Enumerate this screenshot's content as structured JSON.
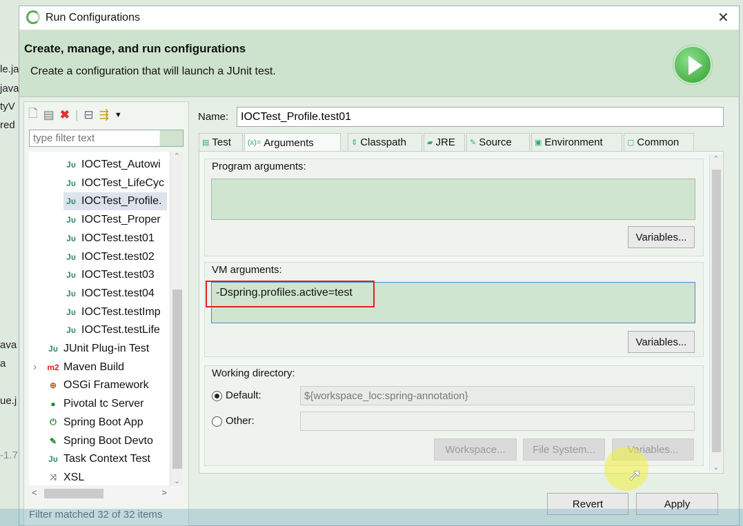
{
  "background_ide": {
    "fragments": [
      "le.ja",
      "java",
      "tyV",
      "red",
      "ava",
      "a",
      "ue.j",
      "-1.7"
    ]
  },
  "window": {
    "title": "Run Configurations",
    "close": "✕"
  },
  "header": {
    "title": "Create, manage, and run configurations",
    "subtitle": "Create a configuration that will launch a JUnit test."
  },
  "left": {
    "filter_placeholder": "type filter text",
    "tree": [
      {
        "icon": "Jυ",
        "label": "IOCTest_Autowi",
        "indent": 1
      },
      {
        "icon": "Jυ",
        "label": "IOCTest_LifeCyc",
        "indent": 1
      },
      {
        "icon": "Jυ",
        "label": "IOCTest_Profile.",
        "indent": 1,
        "selected": true
      },
      {
        "icon": "Jυ",
        "label": "IOCTest_Proper",
        "indent": 1
      },
      {
        "icon": "Jυ",
        "label": "IOCTest.test01",
        "indent": 1
      },
      {
        "icon": "Jυ",
        "label": "IOCTest.test02",
        "indent": 1
      },
      {
        "icon": "Jυ",
        "label": "IOCTest.test03",
        "indent": 1
      },
      {
        "icon": "Jυ",
        "label": "IOCTest.test04",
        "indent": 1
      },
      {
        "icon": "Jυ",
        "label": "IOCTest.testImp",
        "indent": 1
      },
      {
        "icon": "Jυ",
        "label": "IOCTest.testLife",
        "indent": 1
      },
      {
        "icon": "Jυ",
        "label": "JUnit Plug-in Test",
        "indent": 0
      },
      {
        "icon": "m2",
        "label": "Maven Build",
        "indent": 0,
        "expandable": true
      },
      {
        "icon": "⊕",
        "label": "OSGi Framework",
        "indent": 0
      },
      {
        "icon": "●",
        "label": "Pivotal tc Server",
        "indent": 0
      },
      {
        "icon": "⏻",
        "label": "Spring Boot App",
        "indent": 0
      },
      {
        "icon": "✎",
        "label": "Spring Boot Devto",
        "indent": 0
      },
      {
        "icon": "Jυ",
        "label": "Task Context Test",
        "indent": 0
      },
      {
        "icon": "⤨",
        "label": "XSL",
        "indent": 0
      }
    ],
    "status": "Filter matched 32 of 32 items"
  },
  "right": {
    "name_label": "Name:",
    "name_value": "IOCTest_Profile.test01",
    "tabs": [
      {
        "label": "Test",
        "icon": "▤"
      },
      {
        "label": "Arguments",
        "icon": "(x)="
      },
      {
        "label": "Classpath",
        "icon": "⇕"
      },
      {
        "label": "JRE",
        "icon": "▰"
      },
      {
        "label": "Source",
        "icon": "✎"
      },
      {
        "label": "Environment",
        "icon": "▣"
      },
      {
        "label": "Common",
        "icon": "▢"
      }
    ],
    "selected_tab": "Arguments",
    "program_args": {
      "label": "Program arguments:",
      "value": "",
      "variables": "Variables..."
    },
    "vm_args": {
      "label": "VM arguments:",
      "value": "-Dspring.profiles.active=test",
      "variables": "Variables..."
    },
    "working_dir": {
      "label": "Working directory:",
      "default_label": "Default:",
      "default_value": "${workspace_loc:spring-annotation}",
      "other_label": "Other:",
      "other_value": "",
      "selected": "Default",
      "workspace": "Workspace...",
      "file_system": "File System...",
      "variables": "Variables..."
    }
  },
  "footer": {
    "revert": "Revert",
    "apply": "Apply"
  },
  "colors": {
    "header_bg": "#cde3cd",
    "textarea_bg": "#cfe5cf",
    "highlight_box": "#e02020",
    "run_icon": "#3bb03b"
  }
}
